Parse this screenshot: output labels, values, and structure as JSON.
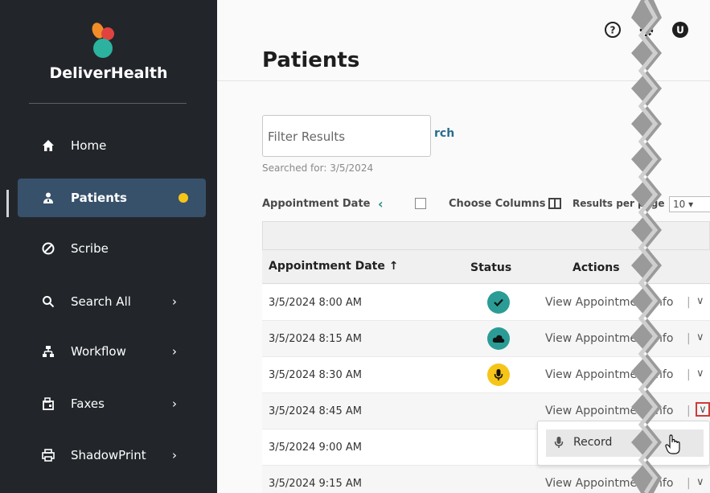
{
  "app": {
    "brand": "DeliverHealth"
  },
  "sidebar": {
    "items": [
      {
        "label": "Home",
        "icon": "home-icon"
      },
      {
        "label": "Patients",
        "icon": "patient-icon",
        "active": true,
        "badge_color": "#f5c518"
      },
      {
        "label": "Scribe",
        "icon": "scribe-icon"
      },
      {
        "label": "Search All",
        "icon": "search-icon",
        "chevron": "›"
      },
      {
        "label": "Workflow",
        "icon": "workflow-icon",
        "chevron": "›"
      },
      {
        "label": "Faxes",
        "icon": "fax-icon",
        "chevron": "›"
      },
      {
        "label": "ShadowPrint",
        "icon": "printer-icon",
        "chevron": "›"
      }
    ]
  },
  "header": {
    "title": "Patients",
    "icons": [
      "help-icon",
      "settings-icon",
      "user-avatar"
    ],
    "avatar_initial": "U"
  },
  "filter": {
    "placeholder": "Filter Results",
    "search_label": "rch",
    "searched_for": "Searched for: 3/5/2024"
  },
  "controls": {
    "appointment_date": "Appointment Date",
    "back_chevron": "‹",
    "choose_columns": "Choose Columns",
    "results_per_page": "Results per page",
    "results_per_page_value": "10"
  },
  "table": {
    "headers": {
      "date": "Appointment Date ↑",
      "status": "Status",
      "actions": "Actions"
    },
    "rows": [
      {
        "date": "3/5/2024 8:00 AM",
        "status": "checked",
        "action": "View Appointment Info"
      },
      {
        "date": "3/5/2024 8:15 AM",
        "status": "cloud",
        "action": "View Appointment Info"
      },
      {
        "date": "3/5/2024 8:30 AM",
        "status": "microphone",
        "action": "View Appointment Info"
      },
      {
        "date": "3/5/2024 8:45 AM",
        "status": "",
        "action": "View Appointment Info"
      },
      {
        "date": "3/5/2024 9:00 AM",
        "status": "",
        "action": ""
      },
      {
        "date": "3/5/2024 9:15 AM",
        "status": "",
        "action": "View Appointment Info"
      }
    ]
  },
  "dropdown": {
    "items": [
      {
        "label": "Record",
        "icon": "microphone-icon"
      }
    ]
  },
  "colors": {
    "sidebar": "#22262b",
    "active": "#37516b",
    "teal": "#2a9c95",
    "yellow": "#f5c518",
    "highlight": "#d03a3a"
  }
}
